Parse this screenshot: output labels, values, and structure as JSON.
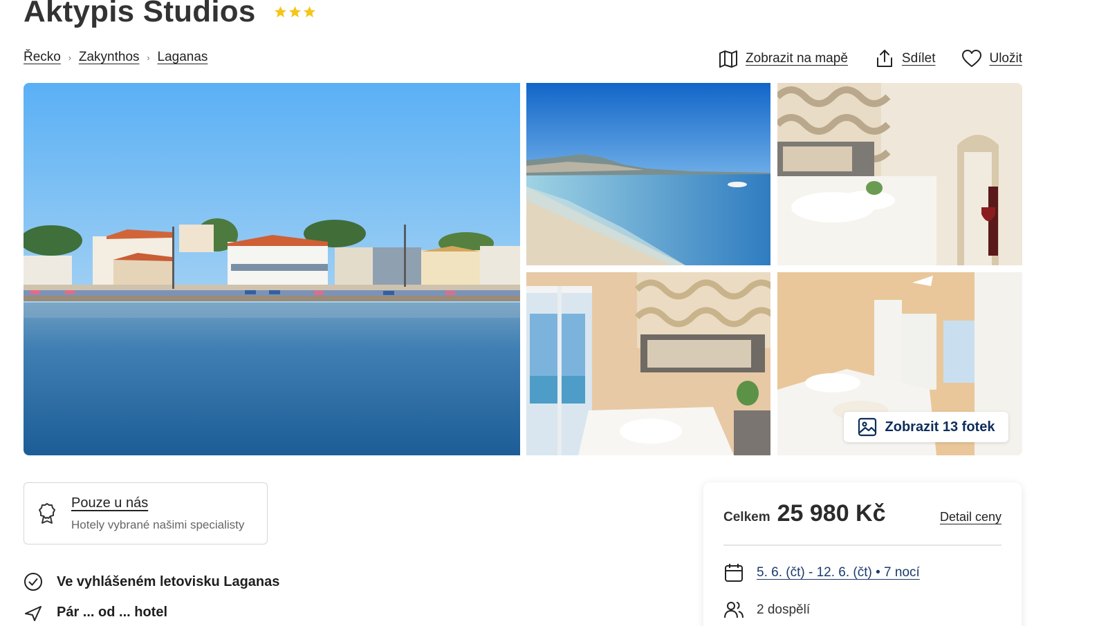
{
  "hotel": {
    "name": "Aktypis Studios",
    "stars": 3,
    "star_color": "#f5c518"
  },
  "breadcrumb": [
    {
      "label": "Řecko"
    },
    {
      "label": "Zakynthos"
    },
    {
      "label": "Laganas"
    }
  ],
  "actions": {
    "map_label": "Zobrazit na mapě",
    "share_label": "Sdílet",
    "save_label": "Uložit",
    "map_icon": "map-icon",
    "share_icon": "share-icon",
    "save_icon": "heart-icon"
  },
  "gallery": {
    "photos": [
      {
        "subject": "harbor"
      },
      {
        "subject": "beach"
      },
      {
        "subject": "room"
      },
      {
        "subject": "room"
      },
      {
        "subject": "room"
      }
    ],
    "show_all_label": "Zobrazit 13 fotek",
    "show_all_icon": "image-icon"
  },
  "exclusive": {
    "title": "Pouze u nás",
    "subtitle": "Hotely vybrané našimi specialisty",
    "icon": "award-icon"
  },
  "features": [
    {
      "label": "Ve vyhlášeném letovisku Laganas",
      "icon": "check-circle-icon"
    },
    {
      "label": "Pár ... od ... hotel",
      "icon": "plane-icon"
    }
  ],
  "price": {
    "total_label": "Celkem",
    "total_value": "25 980 Kč",
    "detail_label": "Detail ceny",
    "dates": "5. 6. (čt) - 12. 6. (čt) • 7 nocí",
    "travelers": "2 dospělí",
    "accent_color": "#1a3a6b"
  }
}
